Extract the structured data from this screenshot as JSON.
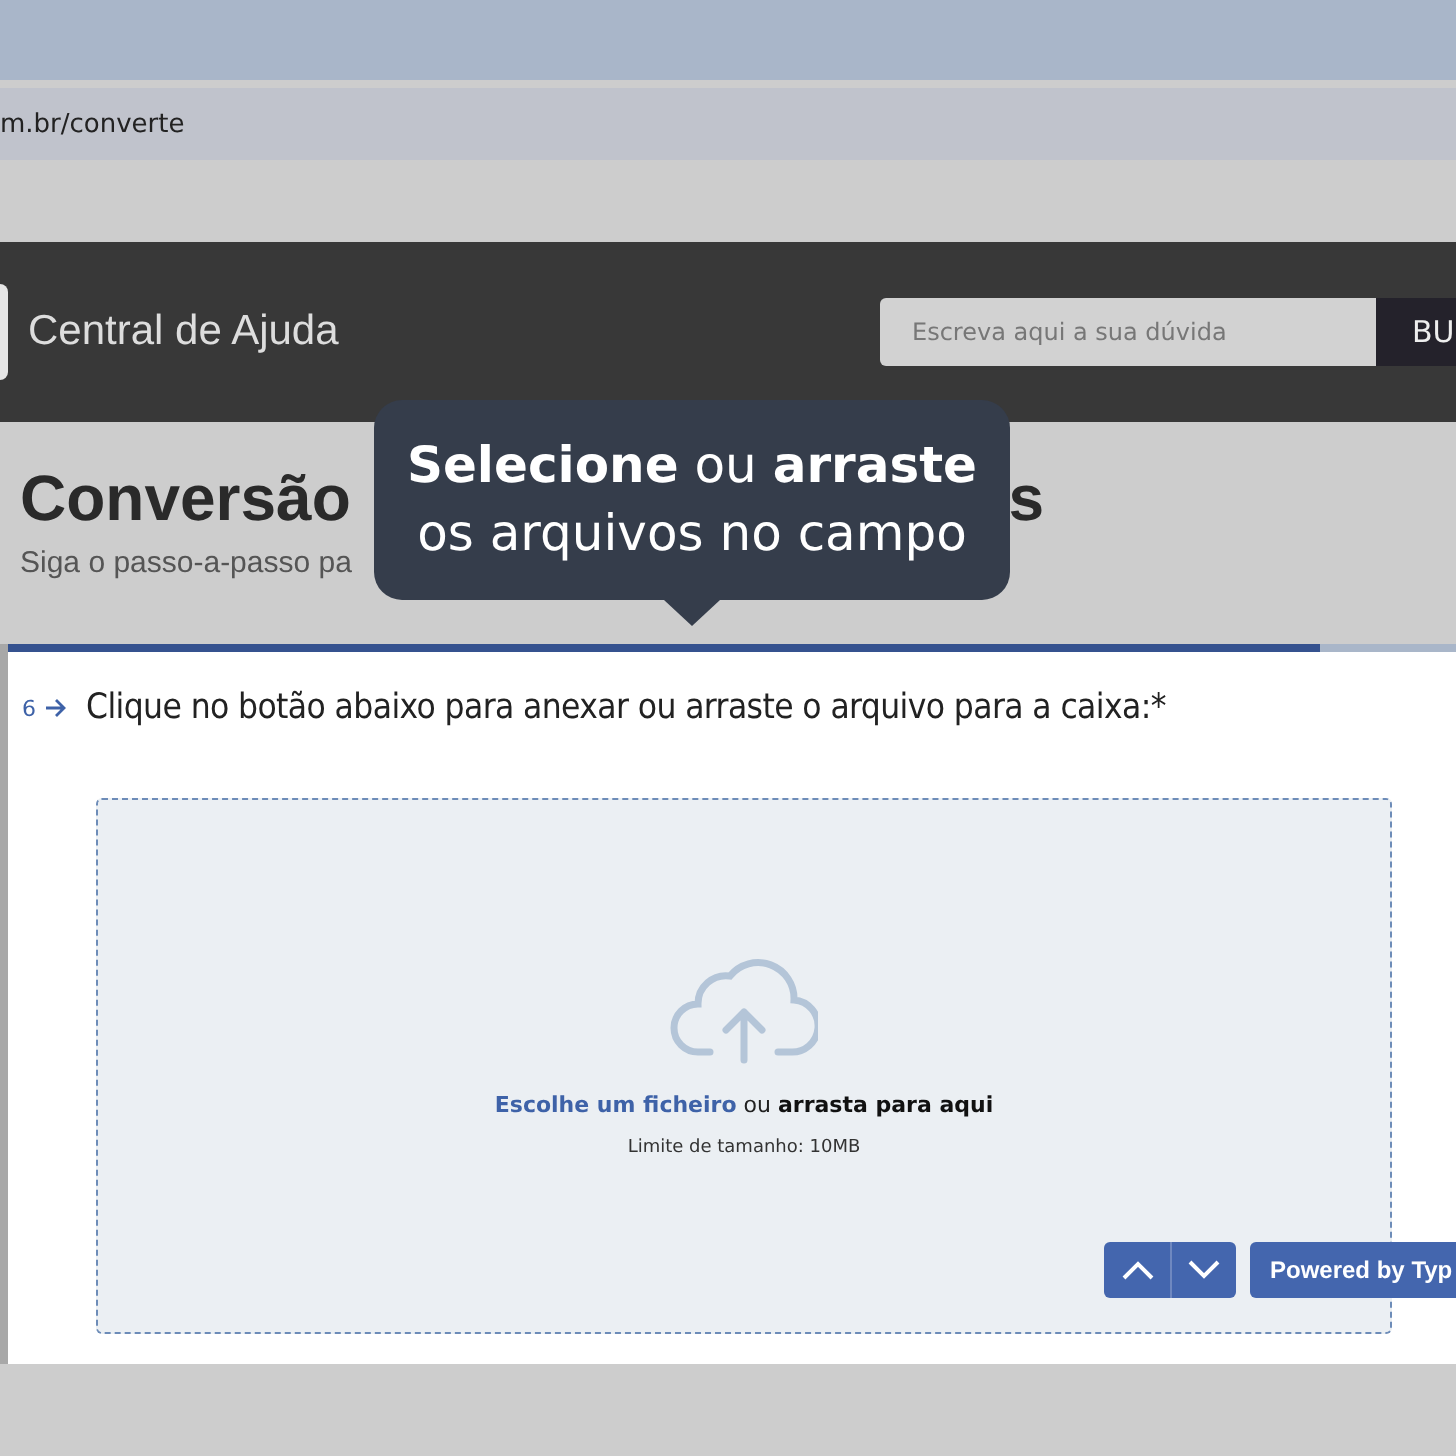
{
  "browser": {
    "url": "m.br/converte"
  },
  "header": {
    "title": "Central de Ajuda",
    "search": {
      "placeholder": "Escreva aqui a sua dúvida"
    },
    "search_button": "BU"
  },
  "page": {
    "heading_start": "Conversão",
    "heading_end": "s",
    "subtitle": "Siga o passo-a-passo pa"
  },
  "tooltip": {
    "line_1": "**Selecione** ou **arraste**",
    "line_2": "os arquivos no campo"
  },
  "form": {
    "progress": {
      "level": 0.906
    },
    "question_number": "6",
    "question": "Clique no botão abaixo para anexar ou arraste o arquivo para a caixa:*",
    "upload": {
      "link": "Escolhe um ficheiro",
      "middle": " ou ",
      "drag": "arrasta para aqui",
      "limit": "Limite de tamanho: 10MB"
    },
    "powered_by": "Powered by Typ"
  }
}
